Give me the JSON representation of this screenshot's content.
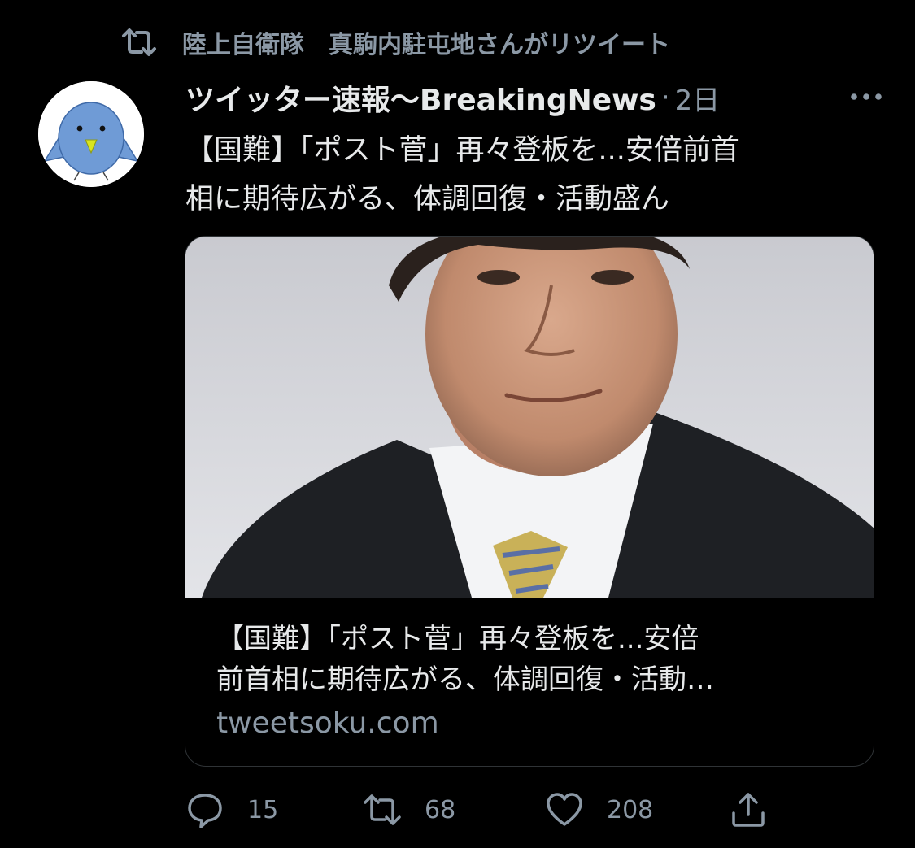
{
  "retweet_context": {
    "icon": "retweet-icon",
    "text": "陸上自衛隊　真駒内駐屯地さんがリツイート"
  },
  "tweet": {
    "author": {
      "display_name": "ツイッター速報〜BreakingNews",
      "avatar_colors": {
        "bird": "#6f9bd6",
        "beak": "#d9e51f",
        "background": "#ffffff"
      }
    },
    "separator": "·",
    "time": "2日",
    "text_line1": "【国難】「ポスト菅」再々登板を...安倍前首",
    "text_line2": "相に期待広がる、体調回復・活動盛ん",
    "card": {
      "title_line1": "【国難】「ポスト菅」再々登板を...安倍",
      "title_line2": "前首相に期待広がる、体調回復・活動…",
      "domain": "tweetsoku.com"
    },
    "actions": {
      "reply_count": "15",
      "retweet_count": "68",
      "like_count": "208"
    }
  },
  "colors": {
    "background": "#000000",
    "primary_text": "#e7e9ea",
    "secondary_text": "#8b98a5",
    "border": "#2f3336"
  }
}
